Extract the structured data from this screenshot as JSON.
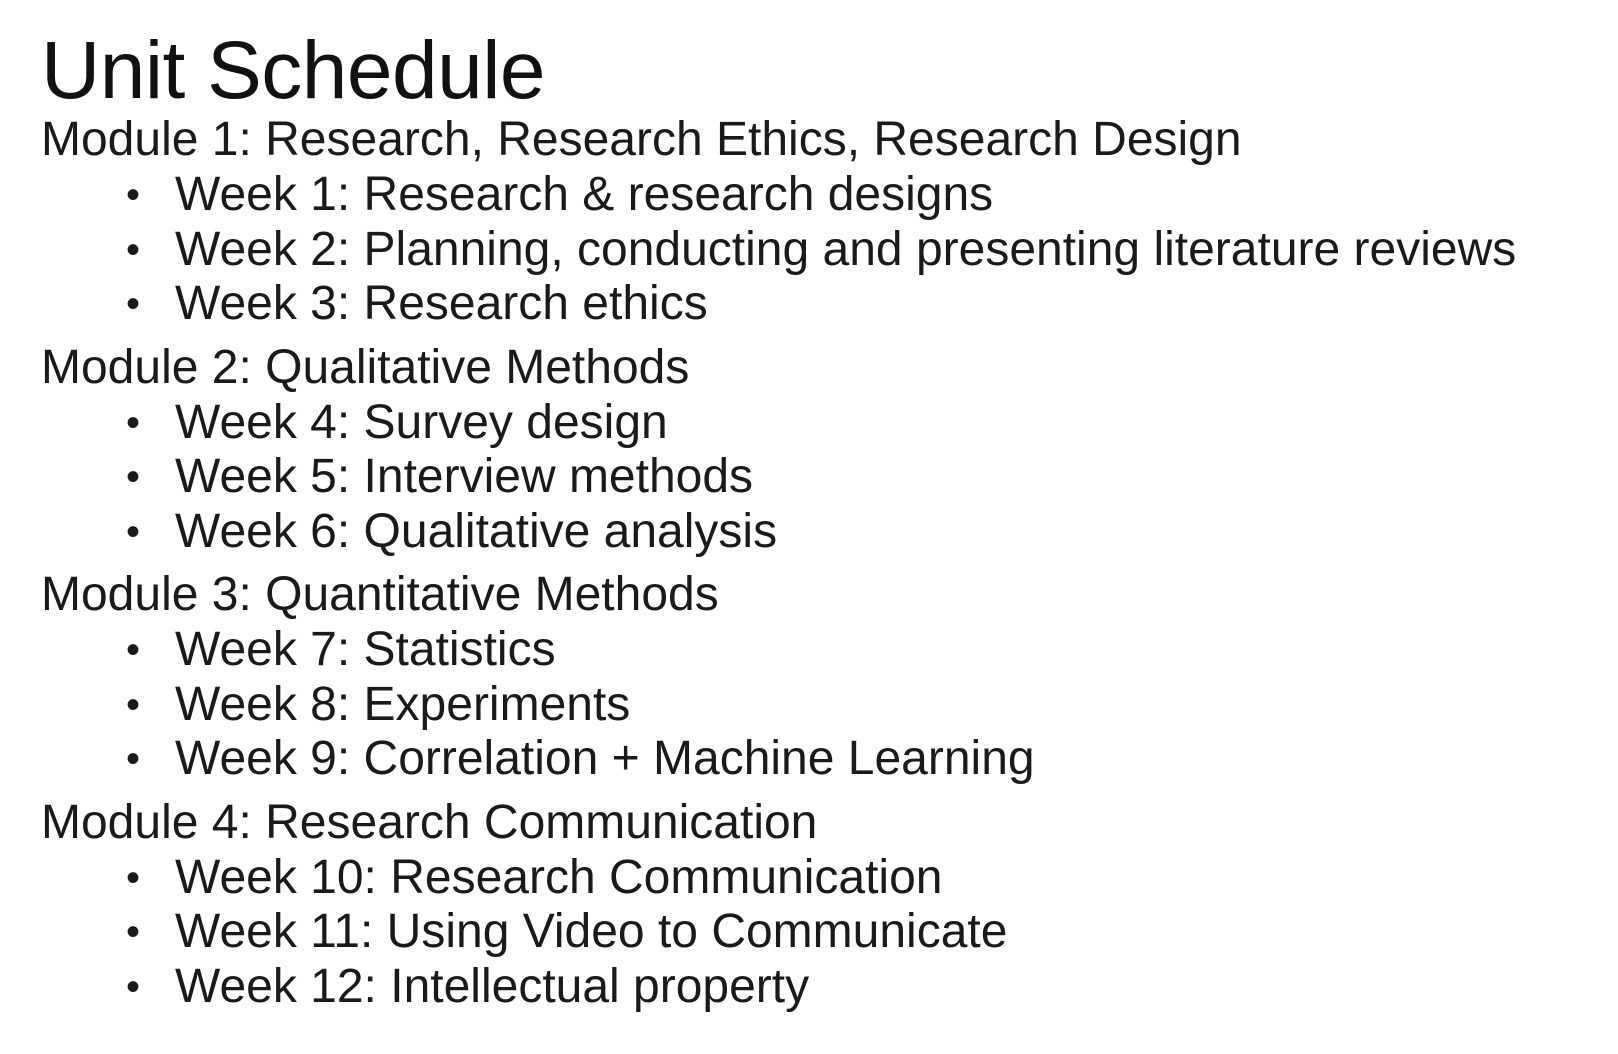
{
  "title": "Unit Schedule",
  "modules": [
    {
      "heading": "Module 1: Research, Research Ethics, Research Design",
      "weeks": [
        "Week 1: Research & research designs",
        "Week 2: Planning, conducting and presenting literature reviews",
        "Week 3: Research ethics"
      ]
    },
    {
      "heading": "Module 2: Qualitative Methods",
      "weeks": [
        "Week 4: Survey design",
        "Week 5: Interview methods",
        "Week 6: Qualitative analysis"
      ]
    },
    {
      "heading": "Module 3: Quantitative Methods",
      "weeks": [
        "Week 7: Statistics",
        "Week 8: Experiments",
        "Week 9: Correlation + Machine Learning"
      ]
    },
    {
      "heading": "Module 4: Research Communication",
      "weeks": [
        "Week 10: Research Communication",
        "Week 11: Using Video to Communicate",
        "Week 12: Intellectual property"
      ]
    }
  ],
  "bullet_glyph": "•"
}
